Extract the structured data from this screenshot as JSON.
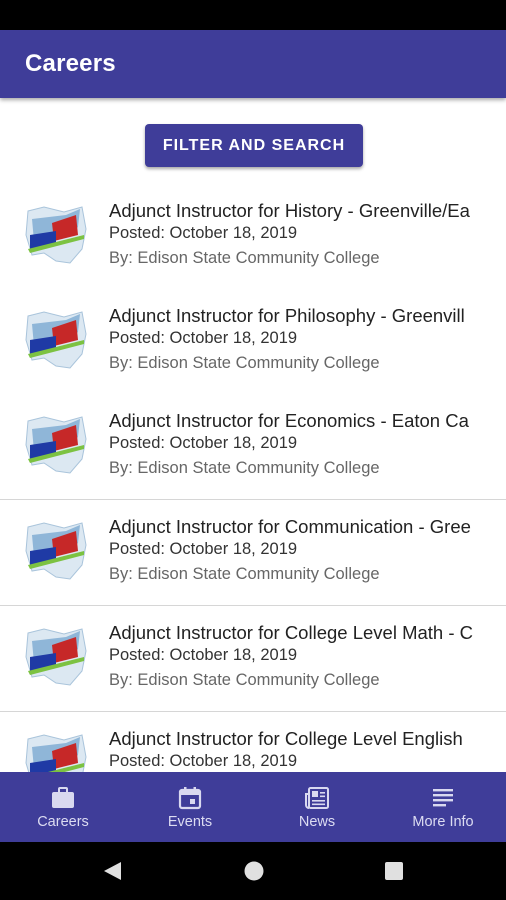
{
  "app": {
    "title": "Careers"
  },
  "filter": {
    "label": "FILTER AND SEARCH"
  },
  "jobs": [
    {
      "title": "Adjunct Instructor for History - Greenville/Ea",
      "posted": "Posted: October 18, 2019",
      "by": "By: Edison State Community College"
    },
    {
      "title": "Adjunct Instructor for Philosophy - Greenvill",
      "posted": "Posted: October 18, 2019",
      "by": "By: Edison State Community College"
    },
    {
      "title": "Adjunct Instructor for Economics - Eaton Ca",
      "posted": "Posted: October 18, 2019",
      "by": "By: Edison State Community College"
    },
    {
      "title": "Adjunct Instructor for Communication - Gree",
      "posted": "Posted: October 18, 2019",
      "by": "By: Edison State Community College"
    },
    {
      "title": "Adjunct Instructor for College Level Math - C",
      "posted": "Posted: October 18, 2019",
      "by": "By: Edison State Community College"
    },
    {
      "title": "Adjunct Instructor for College Level English",
      "posted": "Posted: October 18, 2019",
      "by": ""
    }
  ],
  "nav": [
    {
      "label": "Careers",
      "icon": "briefcase-icon"
    },
    {
      "label": "Events",
      "icon": "calendar-icon"
    },
    {
      "label": "News",
      "icon": "newspaper-icon"
    },
    {
      "label": "More Info",
      "icon": "menu-lines-icon"
    }
  ],
  "colors": {
    "primary": "#3f3d99",
    "statusbar": "#000000"
  }
}
